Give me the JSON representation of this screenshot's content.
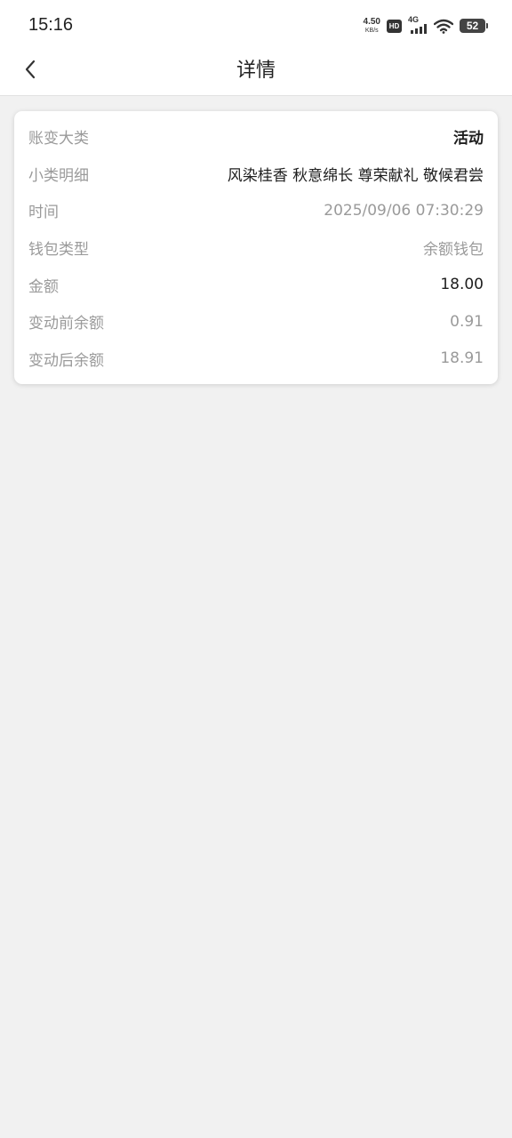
{
  "status_bar": {
    "time": "15:16",
    "net_speed_value": "4.50",
    "net_speed_unit": "KB/s",
    "hd_label": "HD",
    "network_type": "4G",
    "battery_level": "52"
  },
  "header": {
    "title": "详情"
  },
  "details": {
    "category": {
      "label": "账变大类",
      "value": "活动"
    },
    "subcategory": {
      "label": "小类明细",
      "value": "风染桂香 秋意绵长  尊荣献礼  敬候君尝"
    },
    "time": {
      "label": "时间",
      "value": "2025/09/06 07:30:29"
    },
    "wallet_type": {
      "label": "钱包类型",
      "value": "余额钱包"
    },
    "amount": {
      "label": "金额",
      "value": "18.00"
    },
    "balance_before": {
      "label": "变动前余额",
      "value": "0.91"
    },
    "balance_after": {
      "label": "变动后余额",
      "value": "18.91"
    }
  },
  "colors": {
    "page_background": "#f1f1f1",
    "card_background": "#ffffff",
    "label_text": "#9a9a9a",
    "primary_text": "#1e1e1e"
  },
  "icons": {
    "back": "chevron-left-icon",
    "wifi": "wifi-icon",
    "signal": "signal-icon",
    "battery": "battery-icon"
  }
}
